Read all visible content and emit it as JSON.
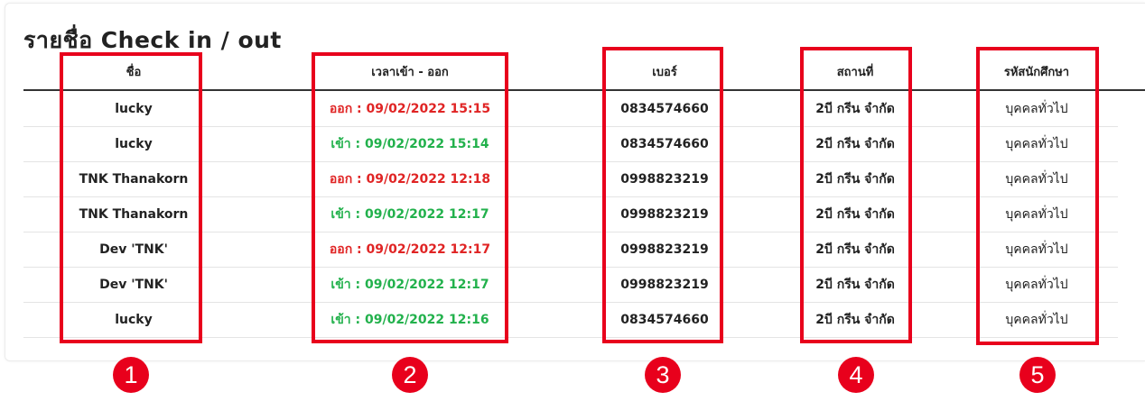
{
  "page": {
    "title": "รายชื่อ Check in / out"
  },
  "table": {
    "columns": [
      "ชื่อ",
      "เวลาเข้า - ออก",
      "เบอร์",
      "สถานที่",
      "รหัสนักศึกษา"
    ],
    "rows": [
      {
        "name": "lucky",
        "time": "ออก : 09/02/2022 15:15",
        "status": "out",
        "phone": "0834574660",
        "place": "2บี กรีน จำกัด",
        "student_id": "บุคคลทั่วไป"
      },
      {
        "name": "lucky",
        "time": "เข้า : 09/02/2022 15:14",
        "status": "in",
        "phone": "0834574660",
        "place": "2บี กรีน จำกัด",
        "student_id": "บุคคลทั่วไป"
      },
      {
        "name": "TNK Thanakorn",
        "time": "ออก : 09/02/2022 12:18",
        "status": "out",
        "phone": "0998823219",
        "place": "2บี กรีน จำกัด",
        "student_id": "บุคคลทั่วไป"
      },
      {
        "name": "TNK Thanakorn",
        "time": "เข้า : 09/02/2022 12:17",
        "status": "in",
        "phone": "0998823219",
        "place": "2บี กรีน จำกัด",
        "student_id": "บุคคลทั่วไป"
      },
      {
        "name": "Dev 'TNK'",
        "time": "ออก : 09/02/2022 12:17",
        "status": "out",
        "phone": "0998823219",
        "place": "2บี กรีน จำกัด",
        "student_id": "บุคคลทั่วไป"
      },
      {
        "name": "Dev 'TNK'",
        "time": "เข้า : 09/02/2022 12:17",
        "status": "in",
        "phone": "0998823219",
        "place": "2บี กรีน จำกัด",
        "student_id": "บุคคลทั่วไป"
      },
      {
        "name": "lucky",
        "time": "เข้า : 09/02/2022 12:16",
        "status": "in",
        "phone": "0834574660",
        "place": "2บี กรีน จำกัด",
        "student_id": "บุคคลทั่วไป"
      }
    ]
  },
  "annotations": {
    "numbers": [
      "1",
      "2",
      "3",
      "4",
      "5"
    ],
    "color": "#e8001c"
  },
  "colors": {
    "out": "#e02424",
    "in": "#22b14c"
  }
}
